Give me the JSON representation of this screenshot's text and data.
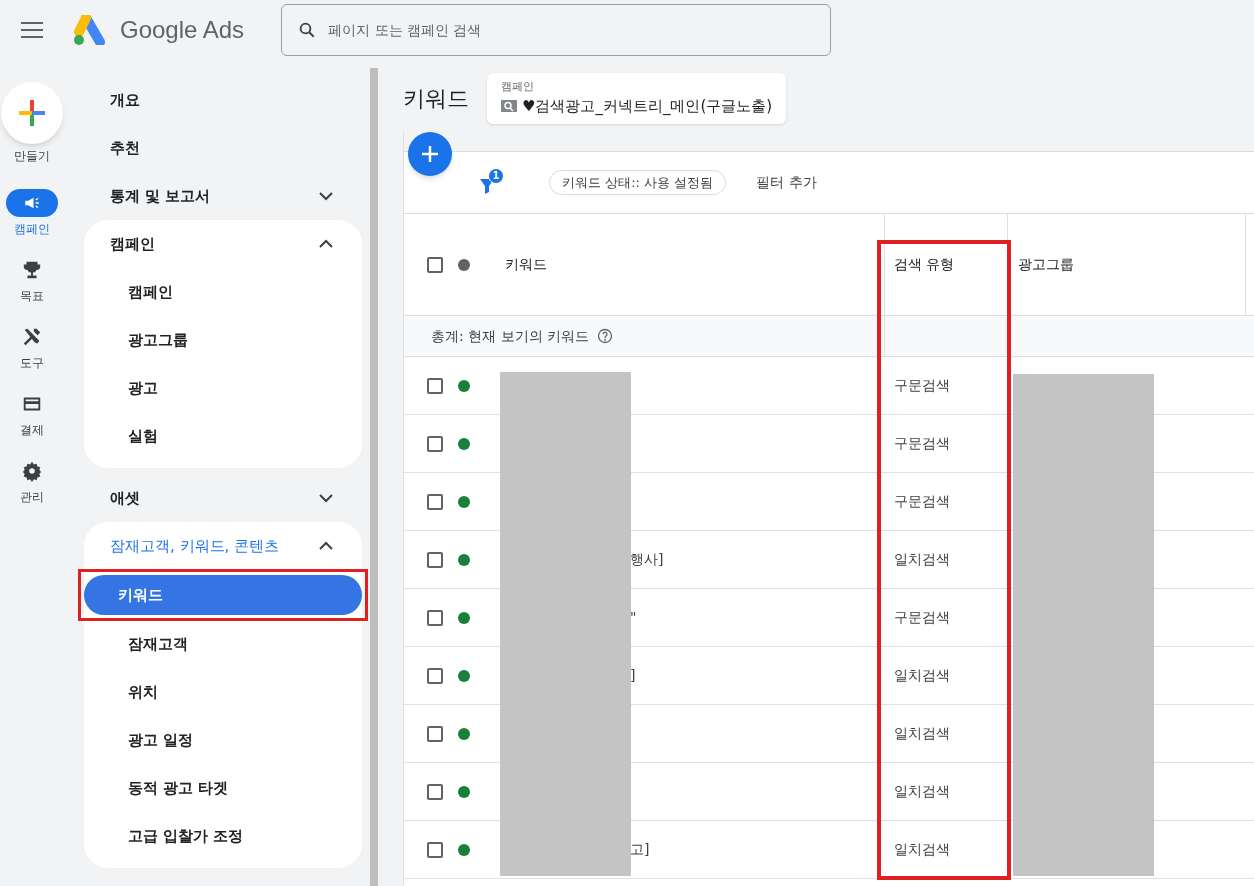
{
  "header": {
    "product": "Google Ads",
    "search_placeholder": "페이지 또는 캠페인 검색"
  },
  "rail": {
    "create_label": "만들기",
    "items": [
      {
        "kind": "campaign",
        "label": "캠페인",
        "selected": true
      },
      {
        "kind": "goals",
        "label": "목표",
        "selected": false
      },
      {
        "kind": "tools",
        "label": "도구",
        "selected": false
      },
      {
        "kind": "billing",
        "label": "결제",
        "selected": false
      },
      {
        "kind": "admin",
        "label": "관리",
        "selected": false
      }
    ]
  },
  "nav": [
    {
      "label": "개요"
    },
    {
      "label": "추천"
    },
    {
      "label": "통계 및 보고서",
      "expanded": false
    },
    {
      "label": "캠페인",
      "expanded": true,
      "active": false,
      "children": [
        {
          "label": "캠페인",
          "selected": false
        },
        {
          "label": "광고그룹",
          "selected": false
        },
        {
          "label": "광고",
          "selected": false
        },
        {
          "label": "실험",
          "selected": false
        }
      ]
    },
    {
      "label": "애셋",
      "expanded": false
    },
    {
      "label": "잠재고객, 키워드, 콘텐츠",
      "expanded": true,
      "active": true,
      "children": [
        {
          "label": "키워드",
          "selected": true,
          "highlight": true
        },
        {
          "label": "잠재고객",
          "selected": false
        },
        {
          "label": "위치",
          "selected": false
        },
        {
          "label": "광고 일정",
          "selected": false
        },
        {
          "label": "동적 광고 타겟",
          "selected": false
        },
        {
          "label": "고급 입찰가 조정",
          "selected": false
        }
      ]
    }
  ],
  "page": {
    "title": "키워드",
    "campaign_label": "캠페인",
    "campaign_name": "♥검색광고_커넥트리_메인(구글노출)"
  },
  "filters": {
    "count": "1",
    "chip": "키워드 상태:: 사용 설정됨",
    "add": "필터 추가"
  },
  "table": {
    "select_all_checked": false,
    "columns": [
      {
        "label": "키워드",
        "highlight": false
      },
      {
        "label": "검색 유형",
        "highlight": true
      },
      {
        "label": "광고그룹",
        "highlight": false
      }
    ],
    "total_label": "총계: 현재 보기의 키워드",
    "rows": [
      {
        "checked": false,
        "color": "#188038",
        "match": "구문검색"
      },
      {
        "checked": false,
        "color": "#188038",
        "match": "구문검색"
      },
      {
        "checked": false,
        "color": "#188038",
        "match": "구문검색"
      },
      {
        "checked": false,
        "color": "#188038",
        "keyword": "행사]",
        "match": "일치검색"
      },
      {
        "checked": false,
        "color": "#188038",
        "keyword": "\"",
        "match": "구문검색"
      },
      {
        "checked": false,
        "color": "#188038",
        "keyword": "]",
        "match": "일치검색"
      },
      {
        "checked": false,
        "color": "#188038",
        "match": "일치검색"
      },
      {
        "checked": false,
        "color": "#188038",
        "match": "일치검색"
      },
      {
        "checked": false,
        "color": "#188038",
        "keyword": "고]",
        "match": "일치검색"
      }
    ]
  }
}
